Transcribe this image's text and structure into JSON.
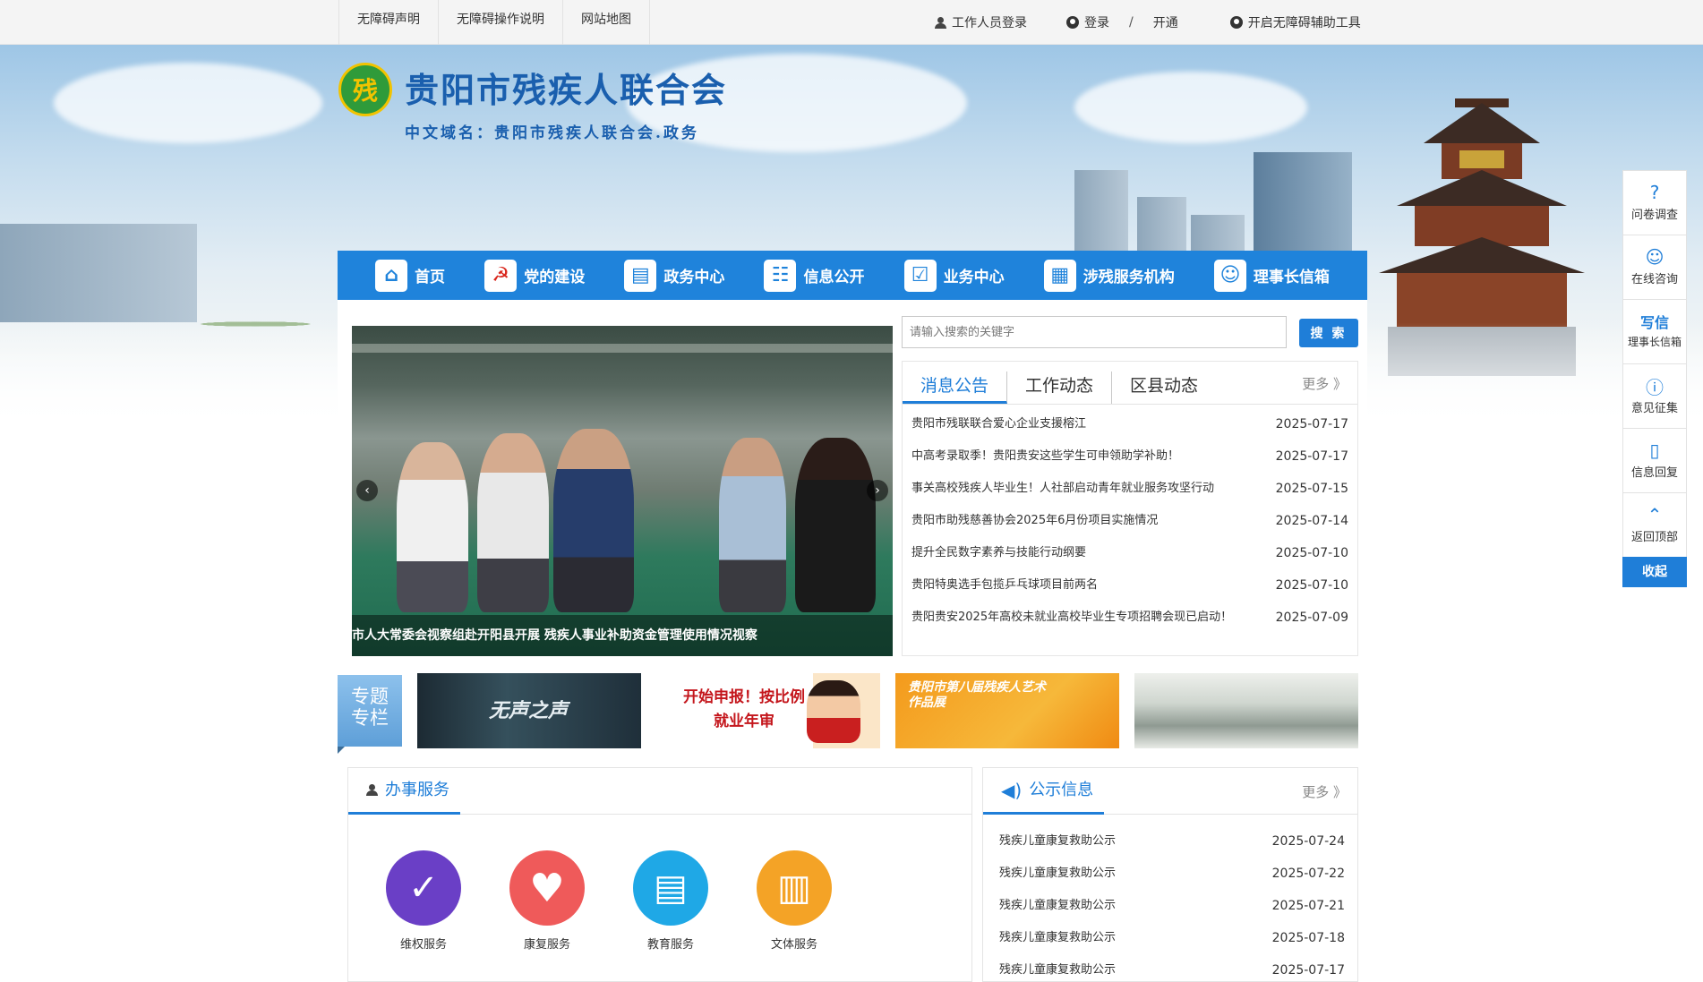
{
  "topbar": {
    "links": [
      "无障碍声明",
      "无障碍操作说明",
      "网站地图"
    ],
    "staff_login": "工作人员登录",
    "login": "登录",
    "separator": "/",
    "open": "开通",
    "accessibility_tool": "开启无障碍辅助工具"
  },
  "header": {
    "site_title": "贵阳市残疾人联合会",
    "domain_name": "中文域名：贵阳市残疾人联合会.政务",
    "logo_char": "残"
  },
  "nav": {
    "items": [
      {
        "label": "首页",
        "icon": "home-icon",
        "glyph": "⌂"
      },
      {
        "label": "党的建设",
        "icon": "party-emblem-icon",
        "glyph": "☭"
      },
      {
        "label": "政务中心",
        "icon": "book-icon",
        "glyph": "▤"
      },
      {
        "label": "信息公开",
        "icon": "document-search-icon",
        "glyph": "☷"
      },
      {
        "label": "业务中心",
        "icon": "checklist-icon",
        "glyph": "☑"
      },
      {
        "label": "涉残服务机构",
        "icon": "institution-icon",
        "glyph": "▦"
      },
      {
        "label": "理事长信箱",
        "icon": "mailbox-person-icon",
        "glyph": "☺"
      }
    ]
  },
  "slider": {
    "caption": "市人大常委会视察组赴开阳县开展 残疾人事业补助资金管理使用情况视察",
    "prev": "‹",
    "next": "›"
  },
  "search": {
    "placeholder": "请输入搜索的关键字",
    "button": "搜 索"
  },
  "news": {
    "tabs": [
      "消息公告",
      "工作动态",
      "区县动态"
    ],
    "more": "更多 》",
    "items": [
      {
        "title": "贵阳市残联联合爱心企业支援榕江",
        "date": "2025-07-17"
      },
      {
        "title": "中高考录取季！贵阳贵安这些学生可申领助学补助！",
        "date": "2025-07-17"
      },
      {
        "title": "事关高校残疾人毕业生！人社部启动青年就业服务攻坚行动",
        "date": "2025-07-15"
      },
      {
        "title": "贵阳市助残慈善协会2025年6月份项目实施情况",
        "date": "2025-07-14"
      },
      {
        "title": "提升全民数字素养与技能行动纲要",
        "date": "2025-07-10"
      },
      {
        "title": "贵阳特奥选手包揽乒乓球项目前两名",
        "date": "2025-07-10"
      },
      {
        "title": "贵阳贵安2025年高校未就业高校毕业生专项招聘会现已启动！",
        "date": "2025-07-09"
      }
    ]
  },
  "special": {
    "label": "专题专栏",
    "line1": "专题",
    "line2": "专栏",
    "thumbs": [
      {
        "text": "无声之声"
      },
      {
        "text": "开始申报！按比例就业年审"
      },
      {
        "text": "贵阳市第八届残疾人艺术作品展"
      },
      {
        "text": ""
      }
    ]
  },
  "services": {
    "title": "办事服务",
    "items": [
      {
        "label": "维权服务",
        "color": "#6a3fc6"
      },
      {
        "label": "康复服务",
        "color": "#ef5a5a"
      },
      {
        "label": "教育服务",
        "color": "#1fa8e6"
      },
      {
        "label": "文体服务",
        "color": "#f4a326"
      }
    ]
  },
  "notice": {
    "title": "公示信息",
    "more": "更多 》",
    "items": [
      {
        "title": "残疾儿童康复救助公示",
        "date": "2025-07-24"
      },
      {
        "title": "残疾儿童康复救助公示",
        "date": "2025-07-22"
      },
      {
        "title": "残疾儿童康复救助公示",
        "date": "2025-07-21"
      },
      {
        "title": "残疾儿童康复救助公示",
        "date": "2025-07-18"
      },
      {
        "title": "残疾儿童康复救助公示",
        "date": "2025-07-17"
      }
    ]
  },
  "float": {
    "items": [
      {
        "label": "问卷调查",
        "glyph": "?"
      },
      {
        "label": "在线咨询",
        "glyph": "☺"
      },
      {
        "label": "理事长信箱",
        "glyph": "写信"
      },
      {
        "label": "意见征集",
        "glyph": "ⓘ"
      },
      {
        "label": "信息回复",
        "glyph": "▯"
      },
      {
        "label": "返回顶部",
        "glyph": "⌃"
      }
    ],
    "collapse": "收起"
  },
  "colors": {
    "primary": "#1f7ed8",
    "nav": "#1f83db",
    "title": "#1a5fae"
  }
}
